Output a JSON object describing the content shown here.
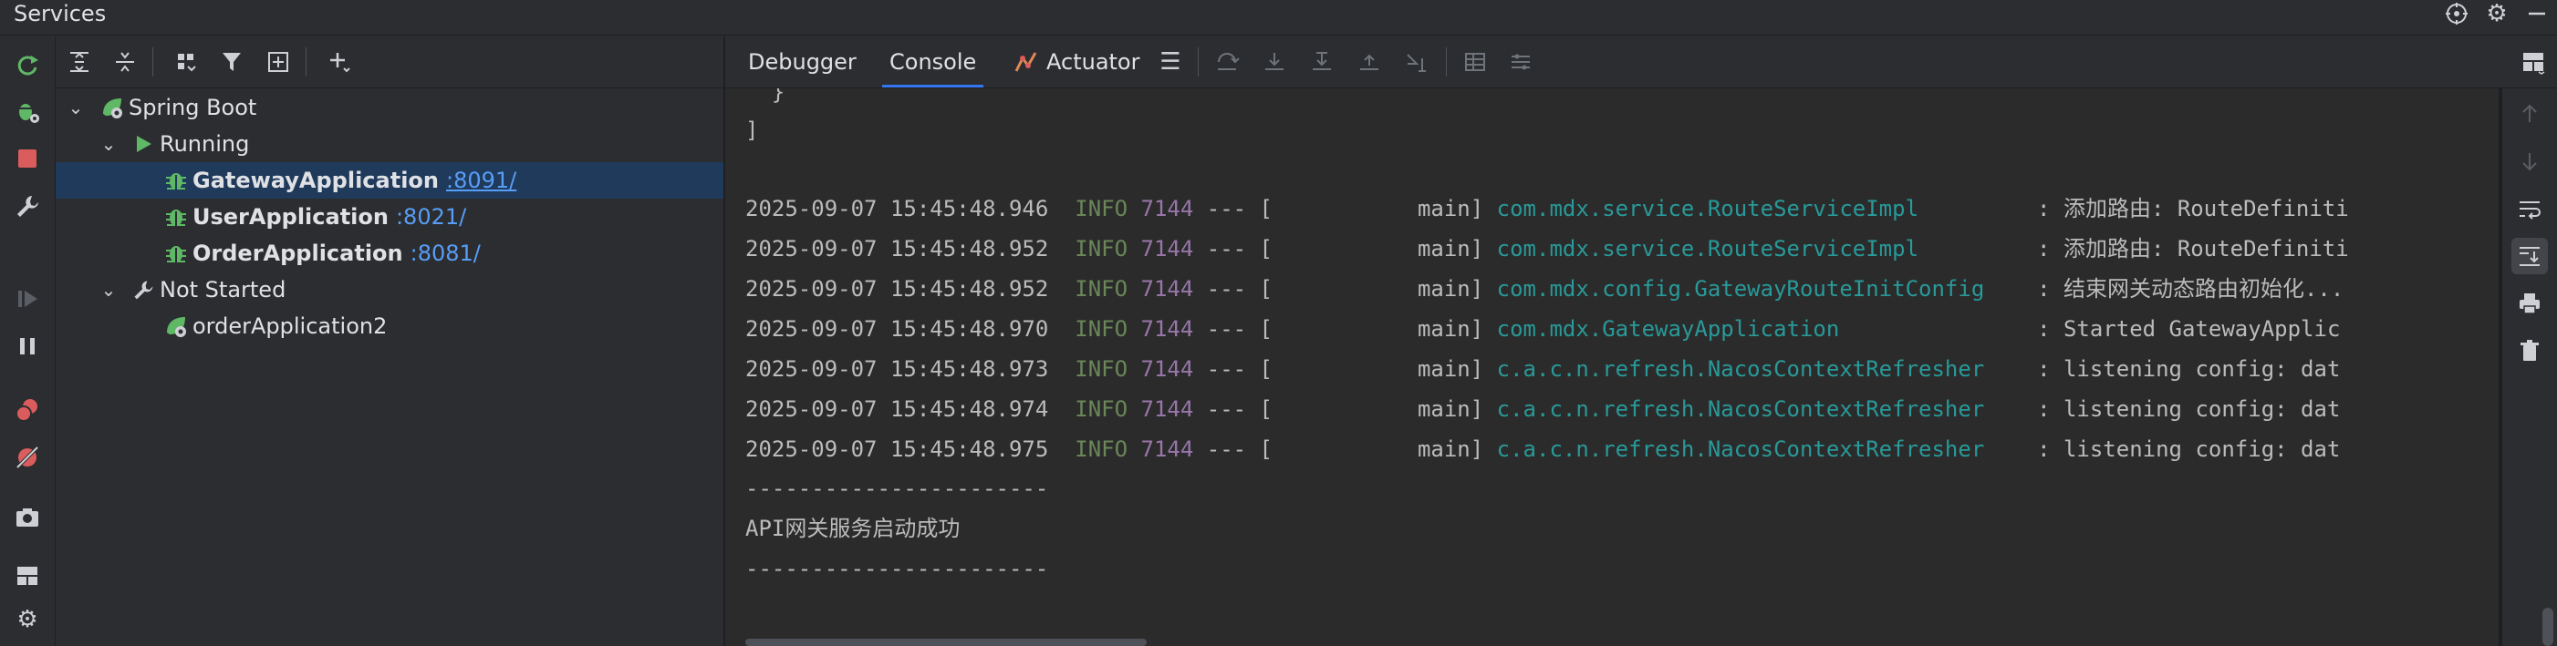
{
  "window": {
    "title": "Services"
  },
  "tree": {
    "items": [
      {
        "label": "Spring Boot"
      },
      {
        "label": "Running"
      },
      {
        "label": "GatewayApplication",
        "port": ":8091/"
      },
      {
        "label": "UserApplication",
        "port": ":8021/"
      },
      {
        "label": "OrderApplication",
        "port": ":8081/"
      },
      {
        "label": "Not Started"
      },
      {
        "label": "orderApplication2"
      }
    ]
  },
  "console": {
    "tabs": [
      {
        "label": "Debugger"
      },
      {
        "label": "Console",
        "active": true
      },
      {
        "label": "Actuator"
      }
    ],
    "lines": [
      {
        "text": "  }"
      },
      {
        "text": "]"
      },
      {
        "text": ""
      },
      {
        "ts": "2025-09-07 15:45:48.946",
        "level": "INFO",
        "pid": "7144",
        "sep": " --- [",
        "thread": "           main]",
        "logger": "com.mdx.service.RouteServiceImpl",
        "msg": "         : 添加路由: RouteDefiniti"
      },
      {
        "ts": "2025-09-07 15:45:48.952",
        "level": "INFO",
        "pid": "7144",
        "sep": " --- [",
        "thread": "           main]",
        "logger": "com.mdx.service.RouteServiceImpl",
        "msg": "         : 添加路由: RouteDefiniti"
      },
      {
        "ts": "2025-09-07 15:45:48.952",
        "level": "INFO",
        "pid": "7144",
        "sep": " --- [",
        "thread": "           main]",
        "logger": "com.mdx.config.GatewayRouteInitConfig",
        "msg": "    : 结束网关动态路由初始化..."
      },
      {
        "ts": "2025-09-07 15:45:48.970",
        "level": "INFO",
        "pid": "7144",
        "sep": " --- [",
        "thread": "           main]",
        "logger": "com.mdx.GatewayApplication",
        "msg": "               : Started GatewayApplic"
      },
      {
        "ts": "2025-09-07 15:45:48.973",
        "level": "INFO",
        "pid": "7144",
        "sep": " --- [",
        "thread": "           main]",
        "logger": "c.a.c.n.refresh.NacosContextRefresher",
        "msg": "    : listening config: dat"
      },
      {
        "ts": "2025-09-07 15:45:48.974",
        "level": "INFO",
        "pid": "7144",
        "sep": " --- [",
        "thread": "           main]",
        "logger": "c.a.c.n.refresh.NacosContextRefresher",
        "msg": "    : listening config: dat"
      },
      {
        "ts": "2025-09-07 15:45:48.975",
        "level": "INFO",
        "pid": "7144",
        "sep": " --- [",
        "thread": "           main]",
        "logger": "c.a.c.n.refresh.NacosContextRefresher",
        "msg": "    : listening config: dat"
      },
      {
        "text": "-----------------------"
      },
      {
        "text": "API网关服务启动成功"
      },
      {
        "text": "-----------------------"
      }
    ]
  },
  "colors": {
    "accent": "#3574f0",
    "selection": "#1f3a5b",
    "run_green": "#5fb865",
    "stop_red": "#db5c5c",
    "debug_green": "#5fb865"
  },
  "icons": {
    "title": [
      "crosshair-icon",
      "gear-icon",
      "minimize-icon"
    ],
    "left": [
      "rerun-icon",
      "debug-icon",
      "stop-icon",
      "wrench-icon",
      "resume-icon",
      "pause-icon",
      "breakpoints-icon",
      "mute-breakpoints-icon",
      "camera-icon",
      "layout-icon",
      "settings-icon"
    ],
    "tree_toolbar": [
      "expand-all-icon",
      "collapse-all-icon",
      "group-by-icon",
      "filter-icon",
      "new-group-icon",
      "add-service-icon"
    ],
    "console_toolbar": [
      "menu-icon",
      "step-over-icon",
      "step-into-icon",
      "force-step-into-icon",
      "step-out-icon",
      "run-to-cursor-icon",
      "evaluate-icon",
      "trace-icon"
    ],
    "right": [
      "layout-icon",
      "scroll-up-icon",
      "scroll-down-icon",
      "soft-wrap-icon",
      "scroll-to-end-icon",
      "print-icon",
      "clear-icon"
    ]
  }
}
